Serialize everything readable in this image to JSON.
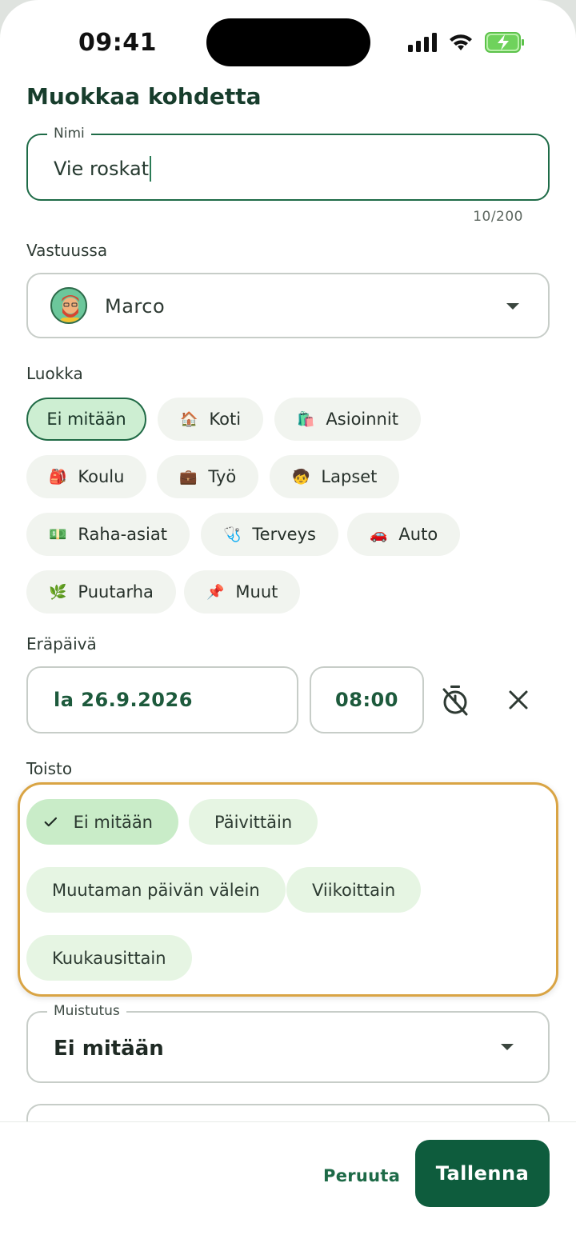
{
  "status": {
    "time": "09:41"
  },
  "page": {
    "title": "Muokkaa kohdetta"
  },
  "name_field": {
    "label": "Nimi",
    "value": "Vie roskat",
    "counter": "10/200"
  },
  "responsible": {
    "label": "Vastuussa",
    "value": "Marco"
  },
  "category": {
    "label": "Luokka",
    "chips": [
      {
        "label": "Ei mitään",
        "emoji": "",
        "selected": true
      },
      {
        "label": "Koti",
        "emoji": "🏠"
      },
      {
        "label": "Asioinnit",
        "emoji": "🛍️"
      },
      {
        "label": "Koulu",
        "emoji": "🎒"
      },
      {
        "label": "Työ",
        "emoji": "💼"
      },
      {
        "label": "Lapset",
        "emoji": "🧒"
      },
      {
        "label": "Raha-asiat",
        "emoji": "💵"
      },
      {
        "label": "Terveys",
        "emoji": "🩺"
      },
      {
        "label": "Auto",
        "emoji": "🚗"
      },
      {
        "label": "Puutarha",
        "emoji": "🌿"
      },
      {
        "label": "Muut",
        "emoji": "📌"
      }
    ]
  },
  "due": {
    "label": "Eräpäivä",
    "date": "la 26.9.2026",
    "time": "08:00"
  },
  "repeat": {
    "label": "Toisto",
    "options": [
      {
        "label": "Ei mitään",
        "selected": true
      },
      {
        "label": "Päivittäin"
      },
      {
        "label": "Muutaman päivän välein"
      },
      {
        "label": "Viikoittain"
      },
      {
        "label": "Kuukausittain"
      }
    ]
  },
  "reminder": {
    "label": "Muistutus",
    "value": "Ei mitään"
  },
  "actions": {
    "cancel": "Peruuta",
    "save": "Tallenna"
  },
  "colors": {
    "primary": "#0e5c3d",
    "accent_outline": "#d9a444",
    "chip_selected": "#cdeed2"
  }
}
